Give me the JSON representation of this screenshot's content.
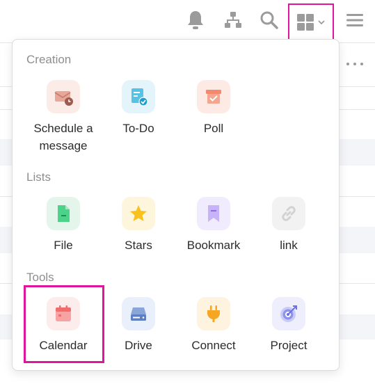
{
  "header": {
    "icons": [
      "bell-icon",
      "org-chart-icon",
      "search-icon",
      "apps-grid-icon",
      "chevron-down-icon",
      "hamburger-menu-icon"
    ]
  },
  "colors": {
    "highlight": "#e0159e",
    "section_title": "#8e8e8e",
    "label": "#2b2b2b",
    "header_icon": "#9b9b9b"
  },
  "menu": {
    "sections": [
      {
        "title": "Creation",
        "items": [
          {
            "label": "Schedule a message",
            "icon": "scheduled-mail-icon"
          },
          {
            "label": "To-Do",
            "icon": "todo-icon"
          },
          {
            "label": "Poll",
            "icon": "poll-box-icon"
          }
        ]
      },
      {
        "title": "Lists",
        "items": [
          {
            "label": "File",
            "icon": "file-icon"
          },
          {
            "label": "Stars",
            "icon": "star-icon"
          },
          {
            "label": "Bookmark",
            "icon": "bookmark-icon"
          },
          {
            "label": "link",
            "icon": "link-icon"
          }
        ]
      },
      {
        "title": "Tools",
        "items": [
          {
            "label": "Calendar",
            "icon": "calendar-icon"
          },
          {
            "label": "Drive",
            "icon": "drive-icon"
          },
          {
            "label": "Connect",
            "icon": "plug-icon"
          },
          {
            "label": "Project",
            "icon": "target-icon"
          }
        ]
      }
    ]
  }
}
